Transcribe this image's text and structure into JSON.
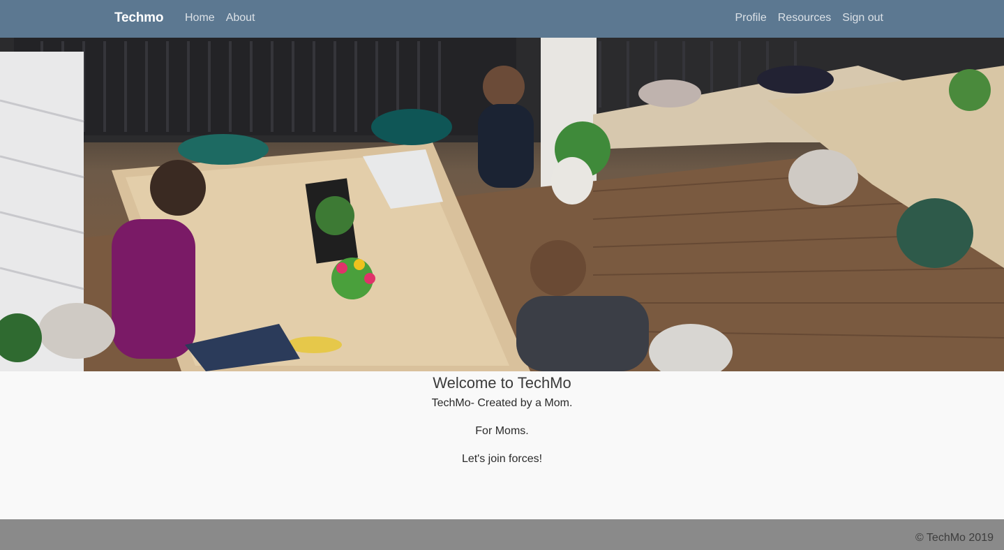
{
  "navbar": {
    "brand": "Techmo",
    "left_links": [
      "Home",
      "About"
    ],
    "right_links": [
      "Profile",
      "Resources",
      "Sign out"
    ]
  },
  "hero": {
    "image": "office-coworking-photo"
  },
  "main": {
    "title": "Welcome to TechMo",
    "lines": [
      "TechMo- Created by a Mom.",
      "For Moms.",
      "Let's join forces!"
    ]
  },
  "footer": {
    "copyright": "© TechMo 2019"
  },
  "colors": {
    "navbar": "#5c7891",
    "footer": "#8a8a8a",
    "background": "#f9f9f9"
  }
}
